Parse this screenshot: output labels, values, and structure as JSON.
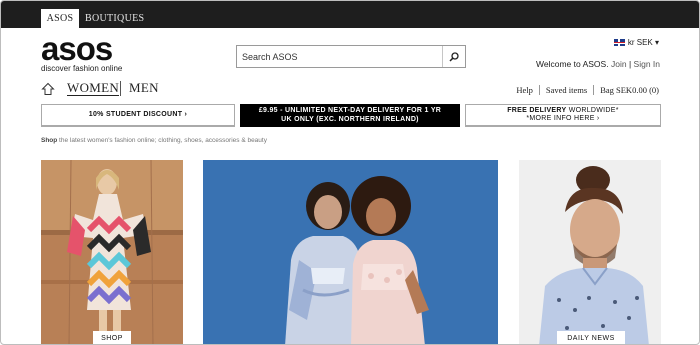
{
  "store_tabs": [
    {
      "label": "ASOS"
    },
    {
      "label": "BOUTIQUES"
    }
  ],
  "logo": {
    "word": "asos",
    "tagline": "discover fashion online"
  },
  "search": {
    "placeholder": "Search ASOS"
  },
  "currency": {
    "label": "kr SEK ▾"
  },
  "account": {
    "welcome": "Welcome to ASOS.",
    "join": "Join",
    "sep": "|",
    "sign_in": "Sign In"
  },
  "nav": {
    "women": "WOMEN",
    "men": "MEN"
  },
  "utility": {
    "help": "Help",
    "saved": "Saved items",
    "bag": "Bag",
    "bag_total": "SEK0.00 (0)"
  },
  "promos": {
    "student": "10% STUDENT DISCOUNT ›",
    "delivery_line1": "£9.95 - UNLIMITED NEXT-DAY DELIVERY FOR 1 YR",
    "delivery_line2": "UK ONLY (EXC. NORTHERN IRELAND)",
    "free_bold": "FREE DELIVERY",
    "free_normal": " WORLDWIDE*",
    "free_more": "*MORE INFO HERE ›"
  },
  "shop_line": {
    "bold": "Shop",
    "text": " the latest women's fashion online; clothing, shoes, accessories & beauty"
  },
  "tiles": {
    "shop_label": "SHOP",
    "news_label": "DAILY NEWS FEED"
  },
  "colors": {
    "topbar": "#1e1e1e",
    "promo_dark": "#000000",
    "tile_blue": "#3f79b8"
  }
}
